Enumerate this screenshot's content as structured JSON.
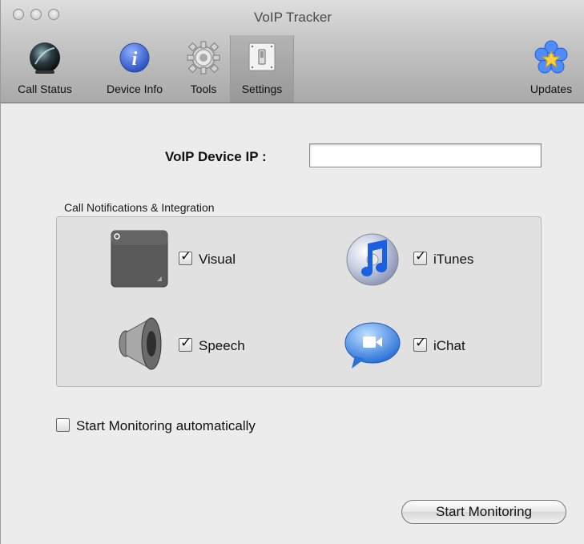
{
  "window": {
    "title": "VoIP Tracker"
  },
  "toolbar": {
    "items": [
      {
        "label": "Call Status",
        "icon": "call-status-orb-icon"
      },
      {
        "label": "Device Info",
        "icon": "info-icon"
      },
      {
        "label": "Tools",
        "icon": "gear-icon"
      },
      {
        "label": "Settings",
        "icon": "switch-icon",
        "selected": true
      },
      {
        "label": "Updates",
        "icon": "flower-icon"
      }
    ]
  },
  "settings": {
    "ip_label": "VoIP Device IP :",
    "ip_value": "",
    "group_label": "Call Notifications & Integration",
    "options": [
      {
        "label": "Visual",
        "checked": true,
        "icon": "visual-notification-icon"
      },
      {
        "label": "iTunes",
        "checked": true,
        "icon": "itunes-icon"
      },
      {
        "label": "Speech",
        "checked": true,
        "icon": "speaker-icon"
      },
      {
        "label": "iChat",
        "checked": true,
        "icon": "ichat-icon"
      }
    ],
    "auto_start_label": "Start Monitoring automatically",
    "auto_start_checked": false,
    "start_button_label": "Start Monitoring"
  },
  "colors": {
    "accent_blue": "#3f66c8",
    "window_bg": "#ececec"
  }
}
